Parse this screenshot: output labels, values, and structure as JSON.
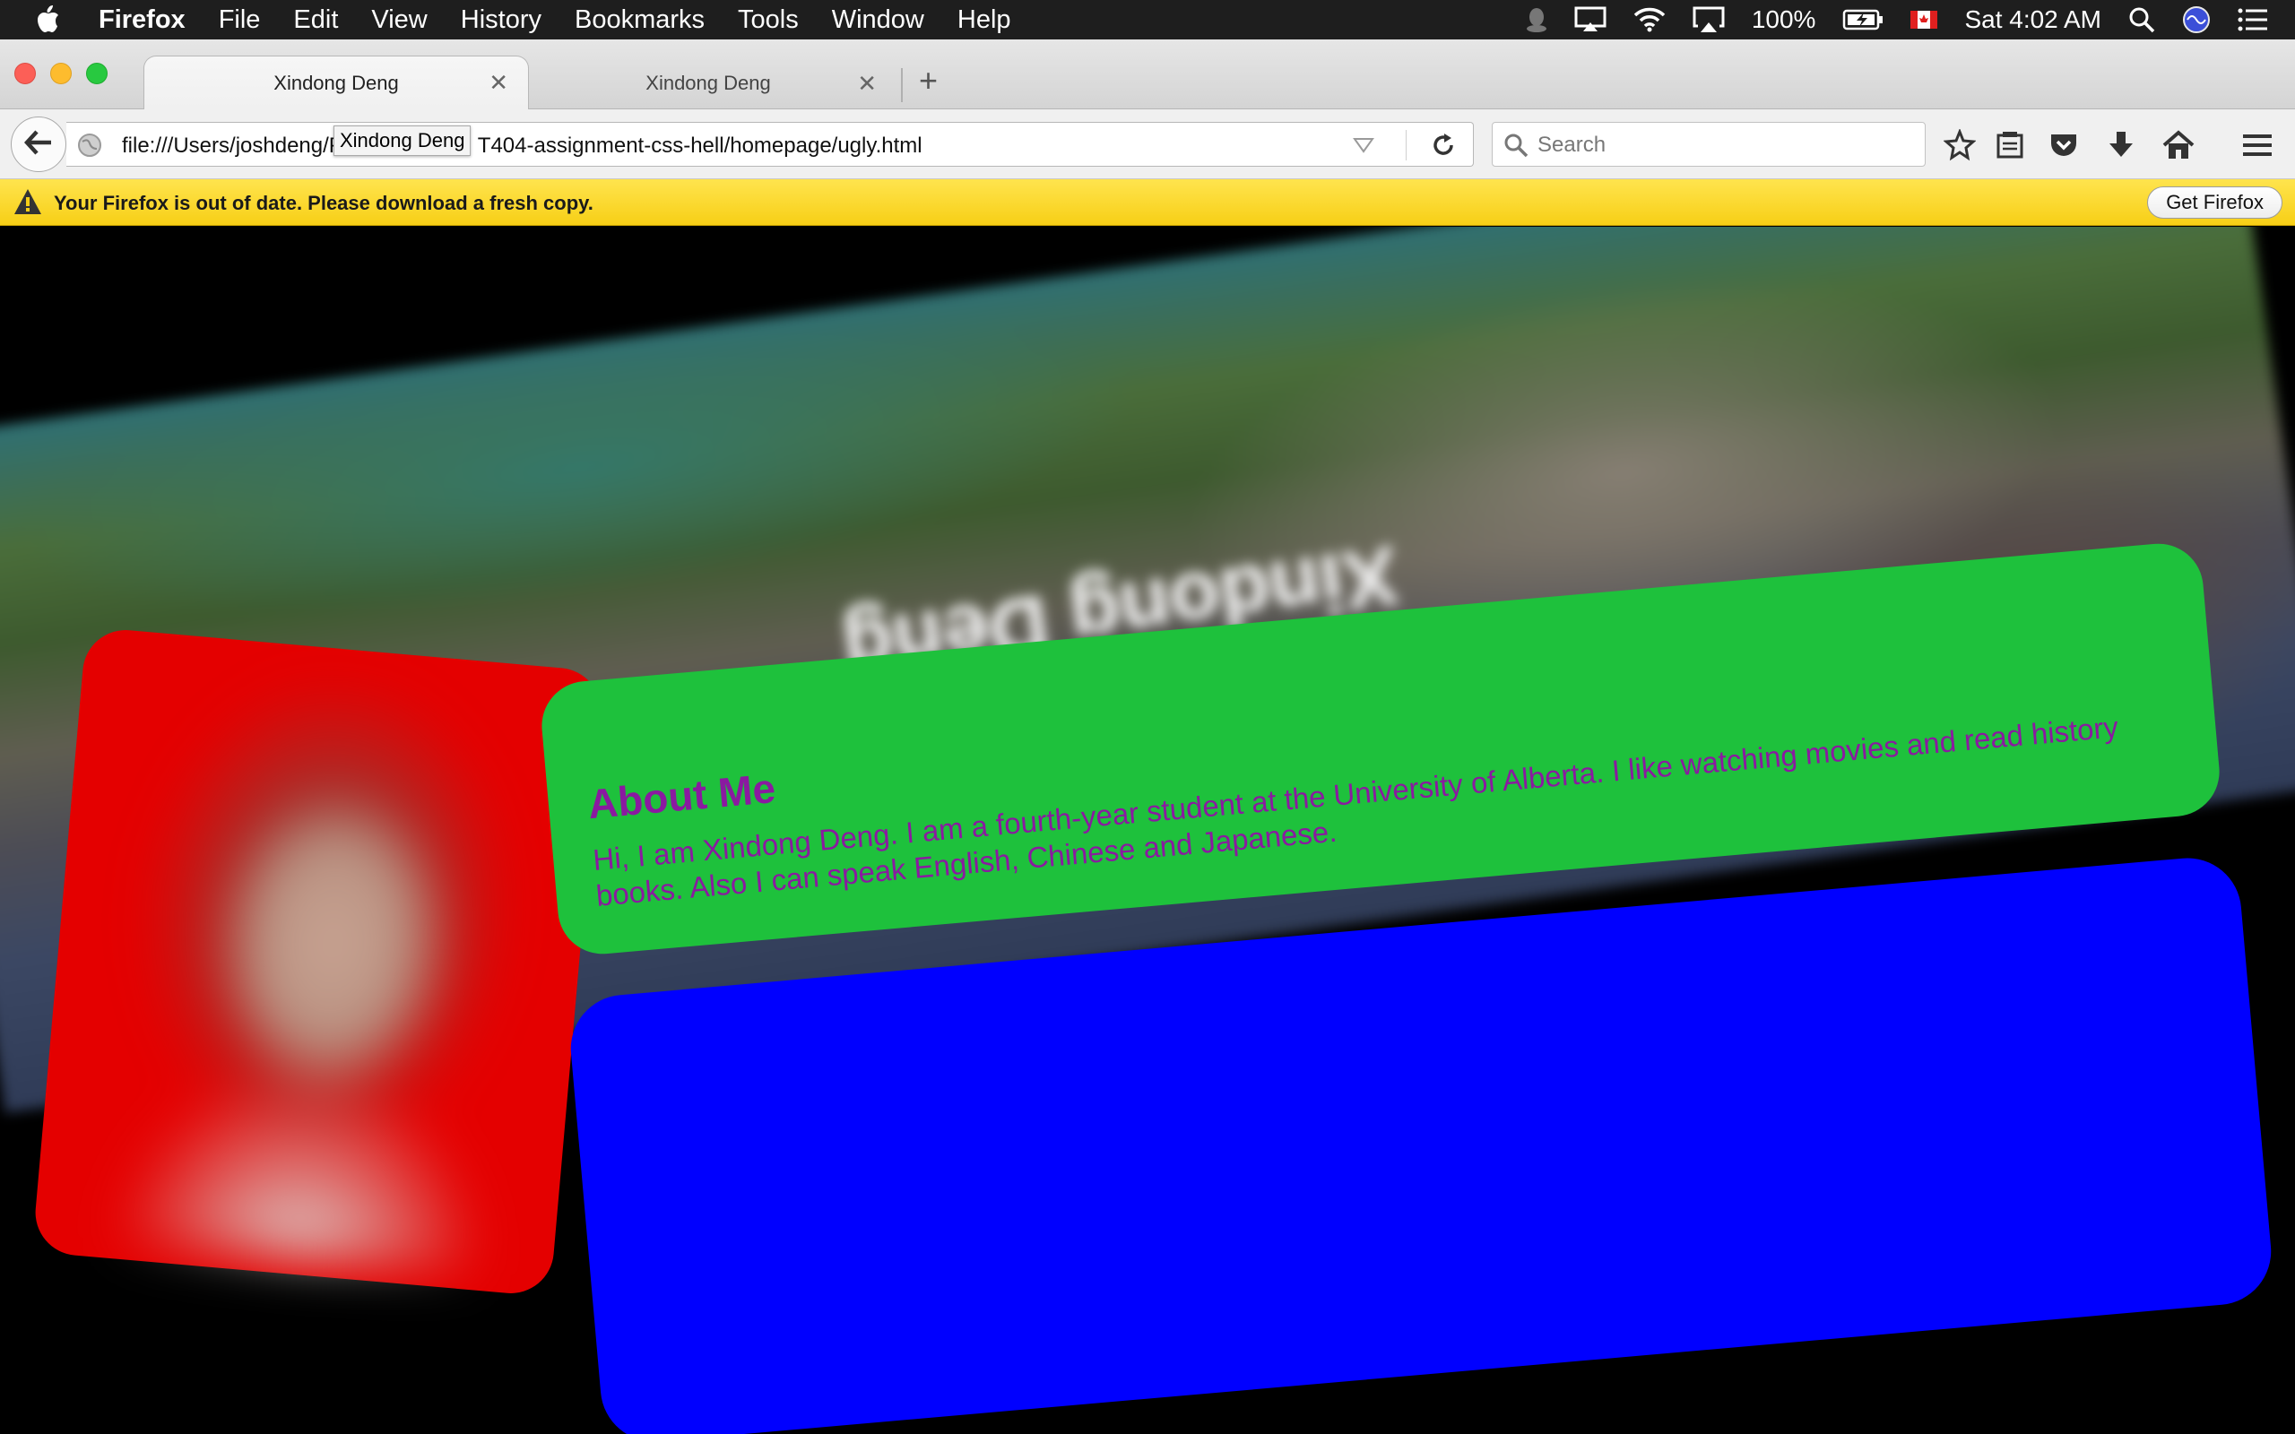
{
  "menubar": {
    "app_name": "Firefox",
    "items": [
      "File",
      "Edit",
      "View",
      "History",
      "Bookmarks",
      "Tools",
      "Window",
      "Help"
    ],
    "battery": "100%",
    "clock": "Sat 4:02 AM"
  },
  "tabs": [
    {
      "title": "Xindong Deng",
      "active": true
    },
    {
      "title": "Xindong Deng",
      "active": false
    }
  ],
  "navbar": {
    "url_visible_start": "file:///Users/joshdeng/P",
    "url_visible_end": "T404-assignment-css-hell/homepage/ugly.html",
    "tooltip": "Xindong Deng",
    "search_placeholder": "Search"
  },
  "notification": {
    "message": "Your Firefox is out of date. Please download a fresh copy.",
    "button_label": "Get Firefox"
  },
  "page": {
    "hero_title": "Xindong Deng",
    "about_heading": "About Me",
    "about_text": "Hi, I am Xindong Deng. I am a fourth-year student at the University of Alberta. I like watching movies and read history books. Also I can speak English, Chinese and Japanese."
  },
  "colors": {
    "about_card": "#1ec13c",
    "about_text": "#8a1aa0",
    "avatar_frame": "#e40000",
    "blue_card": "#0000ff",
    "notification_bar": "#ffd626"
  },
  "icons": [
    "apple-icon",
    "qq-icon",
    "airplay-display-icon",
    "wifi-icon",
    "airplay-icon",
    "battery-icon",
    "flag-canada-icon",
    "spotlight-icon",
    "siri-icon",
    "notification-center-icon",
    "back-arrow-icon",
    "globe-icon",
    "dropmarker-icon",
    "reload-icon",
    "search-icon",
    "bookmark-star-icon",
    "reading-list-icon",
    "pocket-icon",
    "download-icon",
    "home-icon",
    "hamburger-menu-icon",
    "warning-icon"
  ]
}
